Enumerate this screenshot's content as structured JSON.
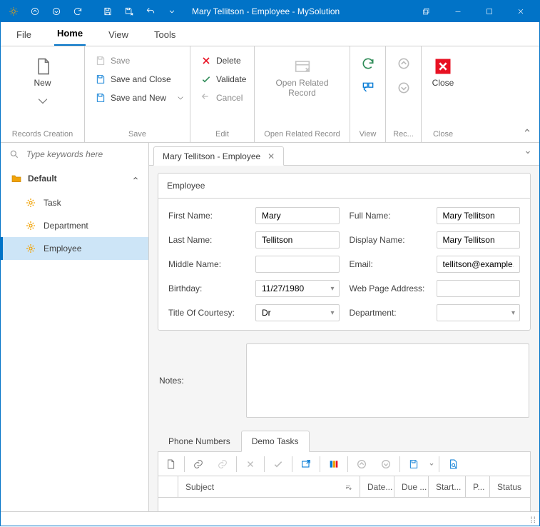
{
  "window": {
    "title": "Mary Tellitson - Employee - MySolution"
  },
  "menu": {
    "file": "File",
    "home": "Home",
    "view": "View",
    "tools": "Tools"
  },
  "ribbon": {
    "new": "New",
    "records_creation": "Records Creation",
    "save": "Save",
    "save_and_close": "Save and Close",
    "save_and_new": "Save and New",
    "save_group": "Save",
    "delete": "Delete",
    "validate": "Validate",
    "cancel": "Cancel",
    "edit_group": "Edit",
    "open_related_record": "Open Related Record",
    "open_related_group": "Open Related Record",
    "view_group": "View",
    "rec_group": "Rec...",
    "close": "Close",
    "close_group": "Close"
  },
  "search": {
    "placeholder": "Type keywords here"
  },
  "nav": {
    "group": "Default",
    "task": "Task",
    "department": "Department",
    "employee": "Employee"
  },
  "doc_tab": "Mary Tellitson - Employee",
  "panel_title": "Employee",
  "fields": {
    "first_name_l": "First Name:",
    "first_name_v": "Mary",
    "last_name_l": "Last Name:",
    "last_name_v": "Tellitson",
    "middle_name_l": "Middle Name:",
    "middle_name_v": "",
    "birthday_l": "Birthday:",
    "birthday_v": "11/27/1980",
    "title_courtesy_l": "Title Of Courtesy:",
    "title_courtesy_v": "Dr",
    "full_name_l": "Full Name:",
    "full_name_v": "Mary Tellitson",
    "display_name_l": "Display Name:",
    "display_name_v": "Mary Tellitson",
    "email_l": "Email:",
    "email_v": "tellitson@example.com",
    "webpage_l": "Web Page Address:",
    "webpage_v": "",
    "department_l": "Department:",
    "department_v": "",
    "notes_l": "Notes:"
  },
  "sub": {
    "tab_phone": "Phone Numbers",
    "tab_tasks": "Demo Tasks"
  },
  "columns": {
    "subject": "Subject",
    "date": "Date...",
    "due": "Due ...",
    "start": "Start...",
    "p": "P...",
    "status": "Status"
  }
}
